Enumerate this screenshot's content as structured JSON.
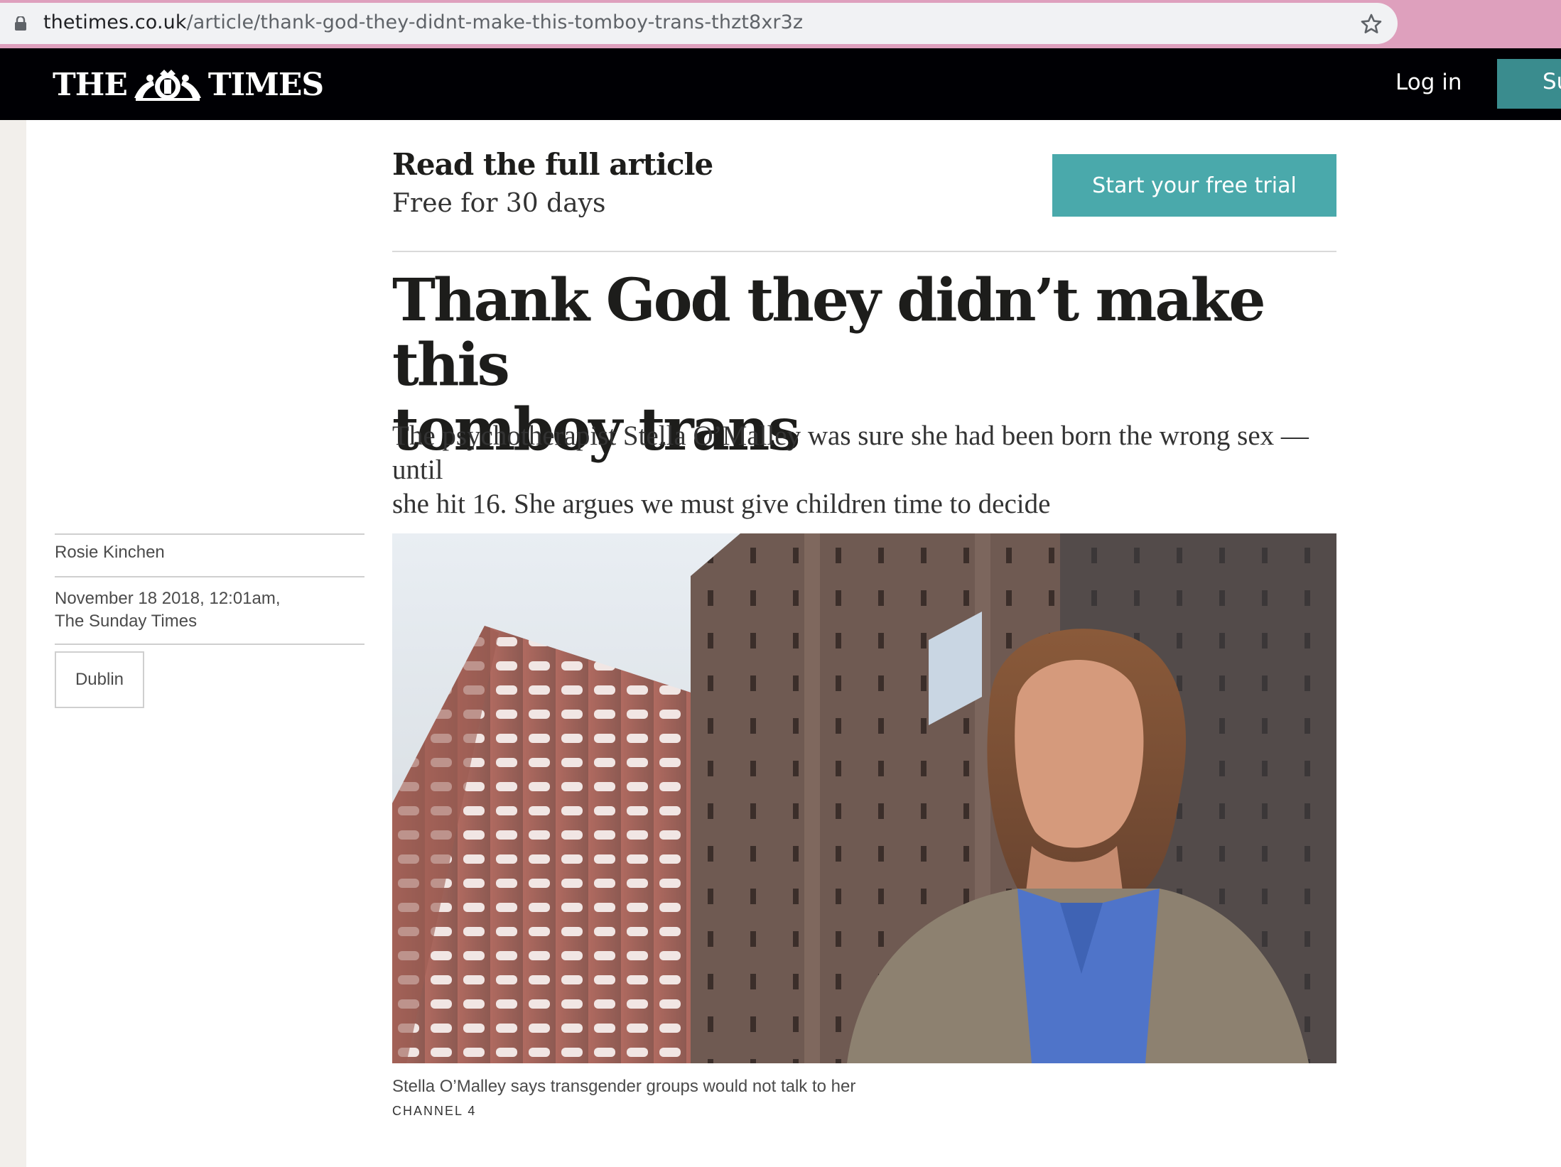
{
  "browser": {
    "url_domain": "thetimes.co.uk",
    "url_path": "/article/thank-god-they-didnt-make-this-tomboy-trans-thzt8xr3z"
  },
  "masthead": {
    "logo_left": "THE",
    "logo_right": "TIMES",
    "login_label": "Log in",
    "subscribe_label": "Su"
  },
  "promo": {
    "title": "Read the full article",
    "subtitle": "Free for 30 days",
    "cta_label": "Start your free trial"
  },
  "article": {
    "headline_line1": "Thank God they didn’t make this",
    "headline_line2": "tomboy trans",
    "standfirst_line1": "The psychotherapist Stella O’Malley was sure she had been born the wrong sex — until",
    "standfirst_line2": "she hit 16. She argues we must give children time to decide",
    "author": "Rosie Kinchen",
    "date": "November 18 2018, 12:01am,",
    "publication": "The Sunday Times",
    "tag": "Dublin",
    "caption": "Stella O’Malley says transgender groups would not talk to her",
    "credit": "CHANNEL 4"
  },
  "colors": {
    "masthead_bg": "#000004",
    "cta_bg": "#4aa9ab",
    "subscribe_bg": "#3a8c8e",
    "chrome_bg": "#dea0bd"
  }
}
